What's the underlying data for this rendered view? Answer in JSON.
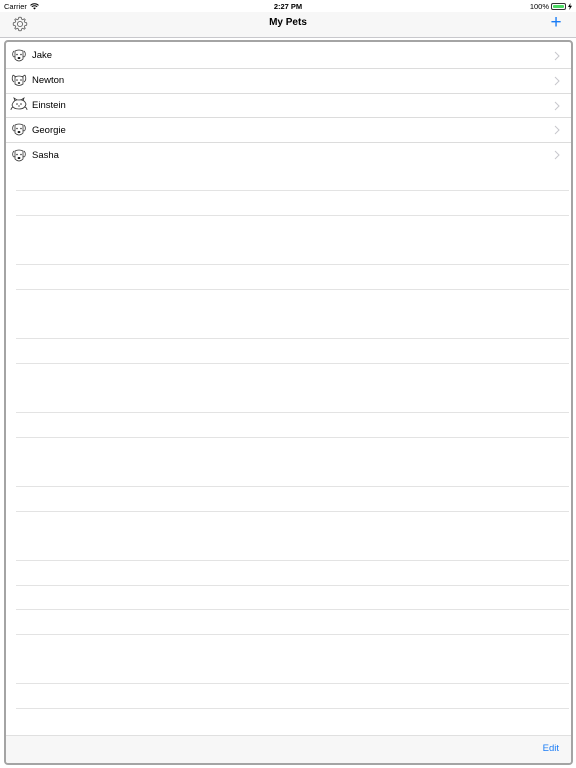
{
  "status": {
    "carrier": "Carrier",
    "time": "2:27 PM",
    "battery": "100%",
    "battery_level": 1.0
  },
  "nav": {
    "title": "My Pets",
    "add_label": "+"
  },
  "pets": [
    {
      "name": "Jake",
      "icon": "dog-icon"
    },
    {
      "name": "Newton",
      "icon": "dog-icon"
    },
    {
      "name": "Einstein",
      "icon": "cat-icon"
    },
    {
      "name": "Georgie",
      "icon": "dog-icon"
    },
    {
      "name": "Sasha",
      "icon": "dog-icon"
    }
  ],
  "toolbar": {
    "edit_label": "Edit"
  },
  "colors": {
    "accent": "#1a7cf5",
    "battery": "#4cd964"
  }
}
